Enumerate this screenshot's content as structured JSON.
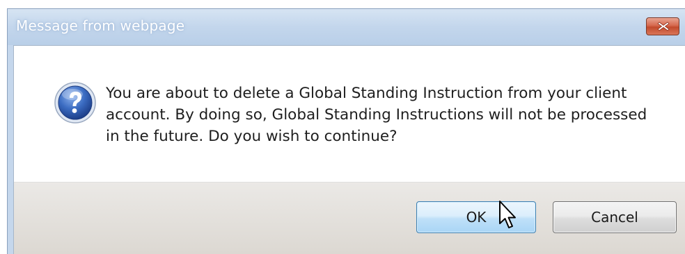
{
  "dialog": {
    "title": "Message from webpage",
    "message": "You are about to delete a Global Standing Instruction from your client account.  By doing so, Global Standing Instructions will not be processed in the future.  Do you wish to continue?",
    "icon": "question-icon",
    "close_icon": "close-icon"
  },
  "buttons": {
    "ok_label": "OK",
    "cancel_label": "Cancel"
  },
  "cursor": {
    "icon": "mouse-pointer-icon"
  },
  "colors": {
    "titlebar": "#c3d6ec",
    "close_button": "#c24a2c",
    "ok_button": "#bfe0f8",
    "footer": "#dcd8d2",
    "icon_blue": "#2b57a8"
  }
}
